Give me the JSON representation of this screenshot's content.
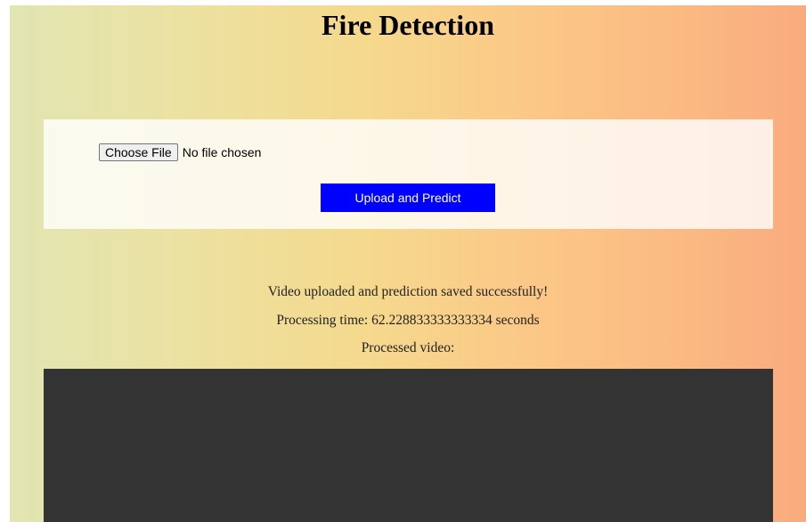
{
  "page": {
    "title": "Fire Detection"
  },
  "upload": {
    "choose_file_label": "Choose File",
    "file_status": "No file chosen",
    "submit_label": "Upload and Predict"
  },
  "result": {
    "success_message": "Video uploaded and prediction saved successfully!",
    "processing_time": "Processing time: 62.228833333333334 seconds",
    "processed_label": "Processed video:"
  },
  "colors": {
    "button_primary": "#0000ff",
    "video_background": "#333333",
    "gradient_start": "#e1e5b2",
    "gradient_end": "#f9ab7e"
  }
}
